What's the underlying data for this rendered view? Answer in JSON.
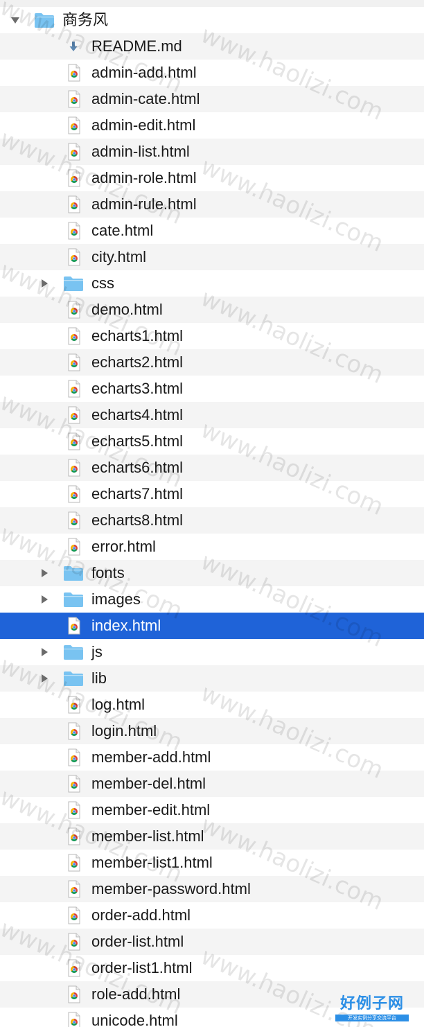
{
  "file_tree": {
    "root": {
      "name": "商务风",
      "kind": "folder",
      "expanded": true
    },
    "items": [
      {
        "name": "README.md",
        "kind": "markdown"
      },
      {
        "name": "admin-add.html",
        "kind": "html"
      },
      {
        "name": "admin-cate.html",
        "kind": "html"
      },
      {
        "name": "admin-edit.html",
        "kind": "html"
      },
      {
        "name": "admin-list.html",
        "kind": "html"
      },
      {
        "name": "admin-role.html",
        "kind": "html"
      },
      {
        "name": "admin-rule.html",
        "kind": "html"
      },
      {
        "name": "cate.html",
        "kind": "html"
      },
      {
        "name": "city.html",
        "kind": "html"
      },
      {
        "name": "css",
        "kind": "folder",
        "expanded": false
      },
      {
        "name": "demo.html",
        "kind": "html"
      },
      {
        "name": "echarts1.html",
        "kind": "html"
      },
      {
        "name": "echarts2.html",
        "kind": "html"
      },
      {
        "name": "echarts3.html",
        "kind": "html"
      },
      {
        "name": "echarts4.html",
        "kind": "html"
      },
      {
        "name": "echarts5.html",
        "kind": "html"
      },
      {
        "name": "echarts6.html",
        "kind": "html"
      },
      {
        "name": "echarts7.html",
        "kind": "html"
      },
      {
        "name": "echarts8.html",
        "kind": "html"
      },
      {
        "name": "error.html",
        "kind": "html"
      },
      {
        "name": "fonts",
        "kind": "folder",
        "expanded": false
      },
      {
        "name": "images",
        "kind": "folder",
        "expanded": false
      },
      {
        "name": "index.html",
        "kind": "html",
        "selected": true
      },
      {
        "name": "js",
        "kind": "folder",
        "expanded": false
      },
      {
        "name": "lib",
        "kind": "folder",
        "expanded": false
      },
      {
        "name": "log.html",
        "kind": "html"
      },
      {
        "name": "login.html",
        "kind": "html"
      },
      {
        "name": "member-add.html",
        "kind": "html"
      },
      {
        "name": "member-del.html",
        "kind": "html"
      },
      {
        "name": "member-edit.html",
        "kind": "html"
      },
      {
        "name": "member-list.html",
        "kind": "html"
      },
      {
        "name": "member-list1.html",
        "kind": "html"
      },
      {
        "name": "member-password.html",
        "kind": "html"
      },
      {
        "name": "order-add.html",
        "kind": "html"
      },
      {
        "name": "order-list.html",
        "kind": "html"
      },
      {
        "name": "order-list1.html",
        "kind": "html"
      },
      {
        "name": "role-add.html",
        "kind": "html"
      },
      {
        "name": "unicode.html",
        "kind": "html"
      }
    ]
  },
  "watermark": {
    "text": "www.haolizi.com"
  },
  "logo": {
    "title": "好例子网",
    "tagline": "开发实例分享交流平台"
  },
  "colors": {
    "selection": "#1f63d8",
    "folder": "#79c3f1",
    "alt_row": "#f4f4f4",
    "logo": "#2c8fe6"
  },
  "icons": {
    "folder": "folder-icon",
    "html": "chrome-html-file-icon",
    "markdown": "markdown-download-file-icon",
    "expanded": "disclosure-triangle-down-icon",
    "collapsed": "disclosure-triangle-right-icon"
  }
}
